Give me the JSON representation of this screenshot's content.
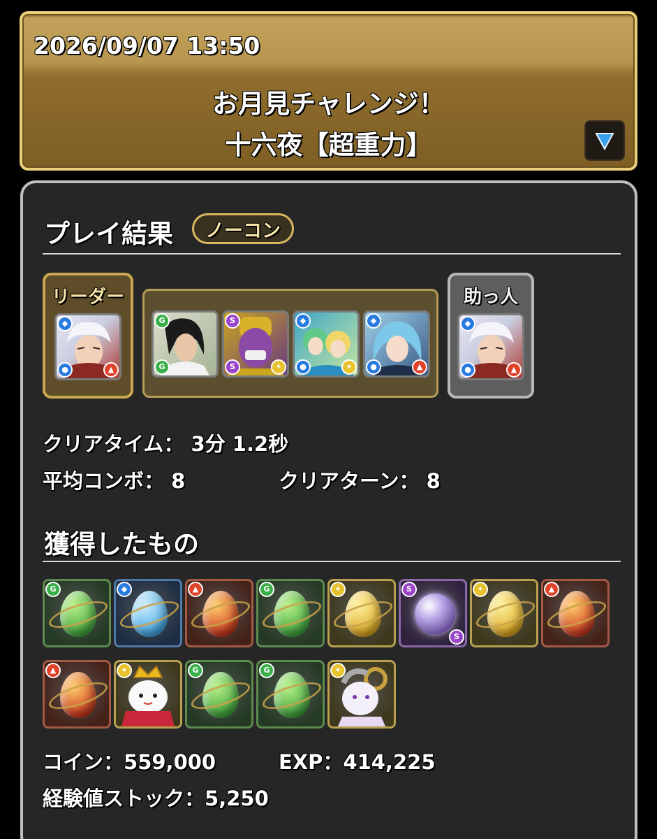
{
  "header": {
    "datetime": "2026/09/07 13:50",
    "dungeon_line1": "お月見チャレンジ！",
    "dungeon_line2": "十六夜【超重力】"
  },
  "result": {
    "title": "プレイ結果",
    "badge": "ノーコン",
    "leader_label": "リーダー",
    "helper_label": "助っ人",
    "clear_time_label": "クリアタイム：",
    "clear_time_value": "3分 1.2秒",
    "avg_combo_label": "平均コンボ：",
    "avg_combo_value": "8",
    "clear_turn_label": "クリアターン：",
    "clear_turn_value": "8"
  },
  "team": {
    "leader": {
      "icon": "samurai-silver-hair",
      "attr": "water",
      "sub": "fire"
    },
    "subs": [
      {
        "icon": "long-hair-swordsman",
        "attr": "wood",
        "sub": "wood"
      },
      {
        "icon": "purple-titan",
        "attr": "dark",
        "sub": "light"
      },
      {
        "icon": "twin-girls",
        "attr": "water",
        "sub": "light"
      },
      {
        "icon": "blue-hair-girl",
        "attr": "water",
        "sub": "fire"
      }
    ],
    "helper": {
      "icon": "samurai-silver-hair",
      "attr": "water",
      "sub": "fire"
    }
  },
  "rewards": {
    "title": "獲得したもの",
    "items": [
      {
        "icon": "green-egg",
        "attr": "wood"
      },
      {
        "icon": "blue-egg",
        "attr": "water"
      },
      {
        "icon": "red-egg",
        "attr": "fire"
      },
      {
        "icon": "green-egg",
        "attr": "wood"
      },
      {
        "icon": "gold-egg",
        "attr": "light"
      },
      {
        "icon": "crystal-orb",
        "attr": "dark"
      },
      {
        "icon": "gold-egg",
        "attr": "light"
      },
      {
        "icon": "red-egg",
        "attr": "fire"
      },
      {
        "icon": "red-egg",
        "attr": "fire"
      },
      {
        "icon": "king-cat",
        "attr": "light"
      },
      {
        "icon": "green-egg",
        "attr": "wood"
      },
      {
        "icon": "green-egg",
        "attr": "wood"
      },
      {
        "icon": "white-goat-mascot",
        "attr": "light"
      }
    ],
    "coin_label": "コイン：",
    "coin_value": "559,000",
    "exp_label": "EXP：",
    "exp_value": "414,225",
    "stock_label": "経験値ストック：",
    "stock_value": "5,250"
  },
  "colors": {
    "fire": "#e0422a",
    "water": "#2a7be0",
    "wood": "#3bb04a",
    "light": "#e8c22c",
    "dark": "#9a45c9",
    "gold_border": "#e9cf7a",
    "panel_bg": "#262626"
  }
}
